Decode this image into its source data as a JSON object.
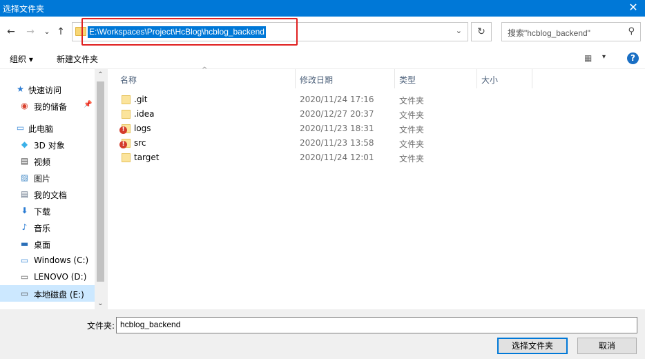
{
  "window": {
    "title": "选择文件夹",
    "close_glyph": "✕"
  },
  "nav": {
    "back_glyph": "←",
    "forward_glyph": "→",
    "recent_glyph": "⌄",
    "up_glyph": "↑",
    "address": "E:\\Workspaces\\Project\\HcBlog\\hcblog_backend",
    "address_dropdown_glyph": "⌄",
    "refresh_glyph": "↻",
    "search_placeholder": "搜索\"hcblog_backend\"",
    "search_glyph": "⚲"
  },
  "toolbar": {
    "organize_label": "组织 ▾",
    "new_folder_label": "新建文件夹",
    "view_glyph": "▦",
    "view_dropdown_glyph": "▾",
    "help_glyph": "?"
  },
  "sidebar": {
    "items": [
      {
        "label": "快速访问",
        "icon": "star-icon",
        "glyph": "★",
        "color": "#2b7cd3",
        "level": 1,
        "pinned": false,
        "selected": false
      },
      {
        "label": "我的储备",
        "icon": "app-icon",
        "glyph": "◉",
        "color": "#d9432f",
        "level": 2,
        "pinned": true,
        "selected": false
      },
      {
        "label": "此电脑",
        "icon": "computer-icon",
        "glyph": "▭",
        "color": "#3a8ad8",
        "level": 1,
        "pinned": false,
        "selected": false
      },
      {
        "label": "3D 对象",
        "icon": "cube-icon",
        "glyph": "◆",
        "color": "#3ab0e8",
        "level": 2,
        "pinned": false,
        "selected": false
      },
      {
        "label": "视频",
        "icon": "video-icon",
        "glyph": "▤",
        "color": "#444444",
        "level": 2,
        "pinned": false,
        "selected": false
      },
      {
        "label": "图片",
        "icon": "picture-icon",
        "glyph": "▨",
        "color": "#4a8ec8",
        "level": 2,
        "pinned": false,
        "selected": false
      },
      {
        "label": "我的文档",
        "icon": "document-icon",
        "glyph": "▤",
        "color": "#6b7a8c",
        "level": 2,
        "pinned": false,
        "selected": false
      },
      {
        "label": "下载",
        "icon": "download-icon",
        "glyph": "⬇",
        "color": "#2b7cd3",
        "level": 2,
        "pinned": false,
        "selected": false
      },
      {
        "label": "音乐",
        "icon": "music-icon",
        "glyph": "♪",
        "color": "#2b7cd3",
        "level": 2,
        "pinned": false,
        "selected": false
      },
      {
        "label": "桌面",
        "icon": "desktop-icon",
        "glyph": "▬",
        "color": "#2b6fb8",
        "level": 2,
        "pinned": false,
        "selected": false
      },
      {
        "label": "Windows (C:)",
        "icon": "windows-drive-icon",
        "glyph": "▭",
        "color": "#3a8ad8",
        "level": 2,
        "pinned": false,
        "selected": false
      },
      {
        "label": "LENOVO (D:)",
        "icon": "drive-icon",
        "glyph": "▭",
        "color": "#666666",
        "level": 2,
        "pinned": false,
        "selected": false
      },
      {
        "label": "本地磁盘 (E:)",
        "icon": "drive-icon",
        "glyph": "▭",
        "color": "#555555",
        "level": 2,
        "pinned": false,
        "selected": true
      }
    ],
    "scroll_up_glyph": "⌃",
    "scroll_down_glyph": "⌄"
  },
  "table": {
    "headers": [
      "名称",
      "修改日期",
      "类型",
      "大小"
    ],
    "sort_glyph": "^",
    "rows": [
      {
        "name": ".git",
        "date": "2020/11/24 17:16",
        "type": "文件夹",
        "error": false
      },
      {
        "name": ".idea",
        "date": "2020/12/27 20:37",
        "type": "文件夹",
        "error": false
      },
      {
        "name": "logs",
        "date": "2020/11/23 18:31",
        "type": "文件夹",
        "error": true
      },
      {
        "name": "src",
        "date": "2020/11/23 13:58",
        "type": "文件夹",
        "error": true
      },
      {
        "name": "target",
        "date": "2020/11/24 12:01",
        "type": "文件夹",
        "error": false
      }
    ],
    "error_glyph": "!"
  },
  "footer": {
    "folder_label": "文件夹:",
    "folder_value": "hcblog_backend",
    "select_button": "选择文件夹",
    "cancel_button": "取消"
  },
  "colors": {
    "accent": "#0078d7",
    "highlight_box": "#e02020",
    "selected_row": "#cce8ff"
  }
}
